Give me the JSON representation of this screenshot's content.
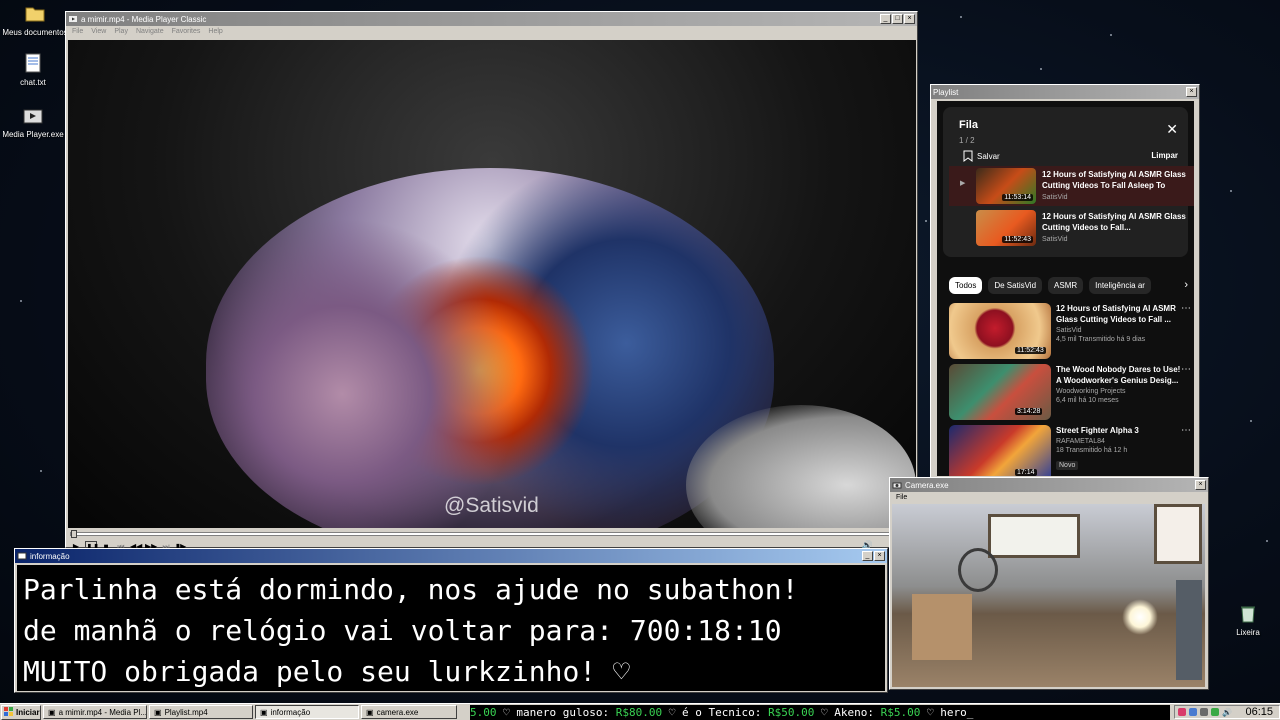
{
  "desktop": {
    "icons": [
      {
        "label": "Meus documentos"
      },
      {
        "label": "chat.txt"
      },
      {
        "label": "Media Player.exe"
      },
      {
        "label": "Lixeira"
      }
    ]
  },
  "player": {
    "title": "a mimir.mp4 - Media Player Classic",
    "menu": [
      "File",
      "View",
      "Play",
      "Navigate",
      "Favorites",
      "Help"
    ],
    "watermark": "@Satisvid"
  },
  "playlist_window": {
    "title": "Playlist",
    "queue": {
      "title": "Fila",
      "count": "1 / 2",
      "save_label": "Salvar",
      "clear_label": "Limpar",
      "items": [
        {
          "title": "12 Hours of Satisfying AI ASMR Glass Cutting Videos To Fall Asleep To",
          "channel": "SatisVid",
          "duration": "11:53:14",
          "active": true
        },
        {
          "title": "12 Hours of Satisfying AI ASMR Glass Cutting Videos to Fall...",
          "channel": "SatisVid",
          "duration": "11:52:43",
          "active": false
        }
      ]
    },
    "chips": [
      "Todos",
      "De SatisVid",
      "ASMR",
      "Inteligência ar"
    ],
    "recommendations": [
      {
        "title": "12 Hours of Satisfying AI ASMR Glass Cutting Videos to Fall ...",
        "channel": "SatisVid",
        "stats": "4,5 mil  Transmitido há 9 dias",
        "duration": "11:52:43",
        "badge": ""
      },
      {
        "title": "The Wood Nobody Dares to Use! A Woodworker's Genius Desig...",
        "channel": "Woodworking Projects",
        "stats": "6,4 mil  há 10 meses",
        "duration": "3:14:28",
        "badge": ""
      },
      {
        "title": "Street Fighter Alpha 3",
        "channel": "RAFAMETAL84",
        "stats": "18  Transmitido há 12 h",
        "duration": "17:14",
        "badge": "Novo"
      }
    ]
  },
  "info_window": {
    "title": "informação",
    "lines": [
      "Parlinha está dormindo, nos ajude no subathon!",
      "de manhã o relógio vai voltar para:  700:18:10",
      "MUITO obrigada pelo seu lurkzinho! ♡"
    ]
  },
  "camera_window": {
    "title": "Camera.exe",
    "menu": "File"
  },
  "taskbar": {
    "start_label": "Iniciar",
    "tasks": [
      {
        "label": "a mimir.mp4 - Media Pl...",
        "pressed": false
      },
      {
        "label": "Playlist.mp4",
        "pressed": false
      },
      {
        "label": "informação",
        "pressed": true
      },
      {
        "label": "camera.exe",
        "pressed": false
      }
    ],
    "ticker": [
      {
        "name": "",
        "amount": "5.00"
      },
      {
        "name": "manero guloso:",
        "amount": "R$80.00"
      },
      {
        "name": "é o Tecnico:",
        "amount": "R$50.00"
      },
      {
        "name": "Akeno:",
        "amount": "R$5.00"
      },
      {
        "name": "hero_",
        "amount": ""
      }
    ],
    "clock": "06:15"
  },
  "colors": {
    "title_active": "#0a246a",
    "title_inactive": "#808080",
    "ticker_amount": "#39d353",
    "yt_bg": "#0f0f0f"
  }
}
